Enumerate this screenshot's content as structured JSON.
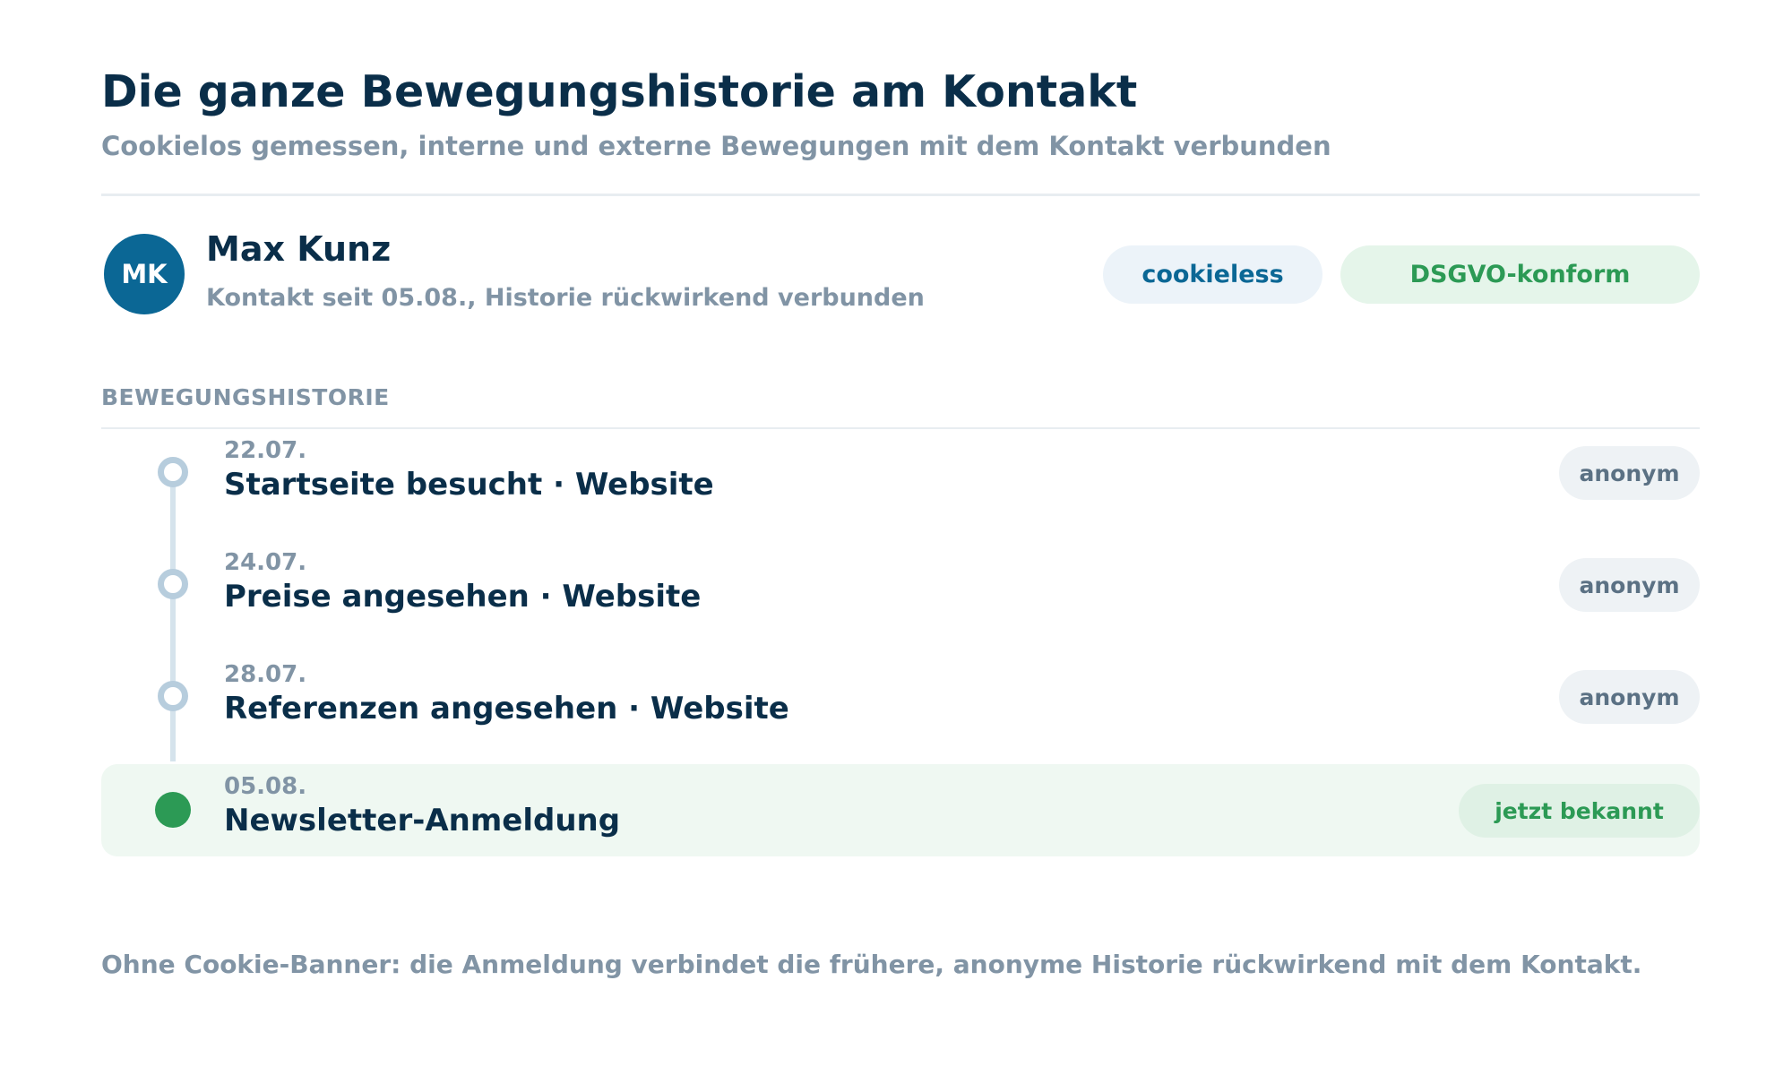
{
  "header": {
    "title": "Die ganze Bewegungshistorie am Kontakt",
    "subtitle": "Cookielos gemessen, interne und externe Bewegungen mit dem Kontakt verbunden"
  },
  "contact": {
    "initials": "MK",
    "name": "Max Kunz",
    "meta": "Kontakt seit 05.08., Historie rückwirkend verbunden",
    "badges": {
      "cookieless": "cookieless",
      "dsgvo": "DSGVO-konform"
    }
  },
  "history": {
    "section_label": "BEWEGUNGSHISTORIE",
    "events": [
      {
        "date": "22.07.",
        "title": "Startseite besucht · Website",
        "status": "anonym"
      },
      {
        "date": "24.07.",
        "title": "Preise angesehen · Website",
        "status": "anonym"
      },
      {
        "date": "28.07.",
        "title": "Referenzen angesehen · Website",
        "status": "anonym"
      },
      {
        "date": "05.08.",
        "title": "Newsletter-Anmeldung",
        "status": "jetzt bekannt"
      }
    ]
  },
  "footer": {
    "note": "Ohne Cookie-Banner: die Anmeldung verbindet die frühere, anonyme Historie rückwirkend mit dem Kontakt."
  },
  "colors": {
    "primary_text": "#0a2e49",
    "muted_text": "#8194a5",
    "brand_blue": "#0b6795",
    "success_green": "#2c9a55",
    "highlight_bg": "#eff8f2"
  },
  "icons": {
    "past_event_marker": "hollow-circle-icon",
    "current_event_marker": "filled-circle-icon"
  }
}
